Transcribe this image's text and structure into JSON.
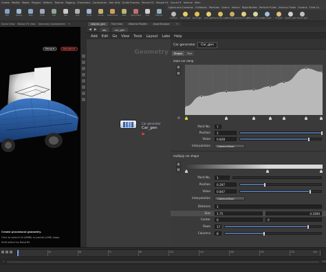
{
  "shelf": {
    "tabs": [
      "Create",
      "Modify",
      "Model",
      "Polygon",
      "Deform",
      "Texture",
      "Rigging",
      "Characters",
      "Constraints",
      "Hair Utils",
      "Guide Process",
      "Terrain FX",
      "Simple FX",
      "Cloud FX",
      "Volume",
      "Main"
    ],
    "tools": [
      {
        "label": "Box",
        "color": "#7fa0c8"
      },
      {
        "label": "Sphere",
        "color": "#9ab8d8"
      },
      {
        "label": "Tube",
        "color": "#88a8c8"
      },
      {
        "label": "Torus",
        "color": "#a0a6c0"
      },
      {
        "label": "Grid",
        "color": "#8ca890"
      },
      {
        "label": "Null",
        "color": "#c9c9c9"
      },
      {
        "label": "Line",
        "color": "#b0b0b0"
      },
      {
        "label": "Circle",
        "color": "#9fb4d6"
      },
      {
        "label": "Curve",
        "color": "#c8b070"
      },
      {
        "label": "Draw Curve",
        "color": "#d0a060"
      },
      {
        "label": "Path",
        "color": "#b8b870"
      },
      {
        "label": "Spray Paint",
        "color": "#c07070"
      },
      {
        "label": "Font",
        "color": "#d0d0d0"
      },
      {
        "label": "Platonic",
        "color": "#8fb0c0"
      }
    ],
    "light_tabs": [
      "Lights and Cameras",
      "Collisions",
      "Particles",
      "Grains",
      "Vellum",
      "Rigid Bodies",
      "Particle Fluids",
      "Viscous Fluids",
      "Oceans",
      "Fluid Co"
    ],
    "light_tools": [
      {
        "label": "Camera",
        "color": "#bbbbbb"
      },
      {
        "label": "Point Light",
        "color": "#e8d060"
      },
      {
        "label": "Spot Light",
        "color": "#e8c050"
      },
      {
        "label": "Area Light",
        "color": "#e0d070"
      },
      {
        "label": "Geometry Light",
        "color": "#d8c060"
      },
      {
        "label": "Volume Light",
        "color": "#c8b060"
      },
      {
        "label": "Distant Light",
        "color": "#e0d080"
      },
      {
        "label": "Environment Light",
        "color": "#d8d8a0"
      },
      {
        "label": "Sky Light",
        "color": "#a0c0e0"
      },
      {
        "label": "GI Light",
        "color": "#e0c080"
      },
      {
        "label": "Caustic Light",
        "color": "#d0d0d0"
      },
      {
        "label": "Portal Light",
        "color": "#c0c0c0"
      }
    ]
  },
  "left_tabs": [
    "Scene View",
    "Motion FX View",
    "Geometry Spreadsheet",
    "+"
  ],
  "viewport": {
    "persp": "Persp ▾",
    "cam": "No cam ▾",
    "info": [
      "Create procedural geometry.",
      "Click to select full (MMB) or partial (LMB) loops.",
      "Shift-select by Road fill."
    ]
  },
  "mid_tabs": [
    {
      "label": "/obj/car_gen",
      "active": true
    },
    {
      "label": "Tree View",
      "active": false
    },
    {
      "label": "Material Palette",
      "active": false
    },
    {
      "label": "Asset Browser",
      "active": false
    },
    {
      "label": "+",
      "active": false
    }
  ],
  "path": [
    "obj",
    "car_gen"
  ],
  "menus": [
    "Add",
    "Edit",
    "Go",
    "View",
    "Tools",
    "Layout",
    "Labs",
    "Help"
  ],
  "network": {
    "context_label": "Geometry",
    "node_type": "Car generator",
    "node_name": "Car_gen"
  },
  "params": {
    "type_label": "Car generator",
    "node_name": "Car_gen",
    "tabs": [
      {
        "label": "Shape",
        "active": true
      },
      {
        "label": "Tire",
        "active": false
      }
    ],
    "ramp1": {
      "title": "main car ramp",
      "points": [
        [
          0.0,
          0.13
        ],
        [
          0.12,
          0.36
        ],
        [
          0.3,
          0.46
        ],
        [
          0.5,
          0.5
        ],
        [
          0.62,
          0.58
        ],
        [
          0.72,
          0.67
        ],
        [
          0.88,
          0.98
        ],
        [
          1.0,
          0.9
        ]
      ],
      "handles": [
        0.0,
        0.3,
        0.5,
        0.62,
        0.72,
        0.88,
        1.0
      ],
      "selected": 0,
      "point_no_label": "Point No.",
      "point_no": "7",
      "position_label": "Position",
      "position": "1",
      "value_label": "Value",
      "value": "0.828",
      "interp_label": "Interpolation",
      "interp": "Catmull-Rom"
    },
    "ramp2": {
      "title": "multiply car shape",
      "handles": [
        0.0,
        0.6,
        1.0
      ],
      "point_no_label": "Point No.",
      "point_no": "1",
      "position_label": "Position",
      "position": "0.297",
      "position_value": 0.297,
      "value_label": "Value",
      "value": "0.847",
      "value_value": 0.847,
      "interp_label": "Interpolation",
      "interp": "Catmull-Rom"
    },
    "distance_label": "Distance",
    "distance": "1",
    "size_label": "Size",
    "size_a": "1.75",
    "size_b": "4.3300",
    "center_label": "Center",
    "center_a": "0",
    "center_b": "0",
    "rows_label": "Rows",
    "rows": "17",
    "rows_value": 17,
    "rows_max": 20,
    "columns_label": "Columns",
    "columns": "8",
    "columns_value": 8,
    "columns_max": 20
  },
  "timeline": {
    "frames": [
      "1",
      "24",
      "48",
      "72",
      "96",
      "120",
      "144",
      "168",
      "192",
      "216",
      "240"
    ],
    "start": "1",
    "end": "240"
  }
}
